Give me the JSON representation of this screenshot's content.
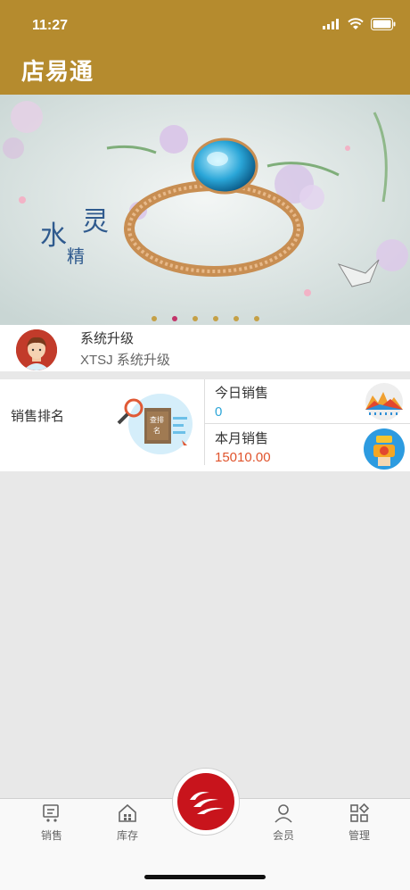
{
  "status": {
    "time": "11:27"
  },
  "app": {
    "title": "店易通"
  },
  "banner": {
    "slide_count": 6,
    "active_index": 1
  },
  "notice": {
    "title": "系统升级",
    "subtitle": "XTSJ 系统升级"
  },
  "sales": {
    "rank_label": "销售排名",
    "today_label": "今日销售",
    "today_value": "0",
    "month_label": "本月销售",
    "month_value": "15010.00"
  },
  "tabs": [
    {
      "label": "销售",
      "icon": "sales-icon"
    },
    {
      "label": "库存",
      "icon": "inventory-icon"
    },
    {
      "label": "会员",
      "icon": "member-icon"
    },
    {
      "label": "管理",
      "icon": "manage-icon"
    }
  ],
  "colors": {
    "brand": "#b58b2e",
    "today_value": "#2ea6d8",
    "month_value": "#e0542d",
    "center_button": "#c8141c"
  }
}
